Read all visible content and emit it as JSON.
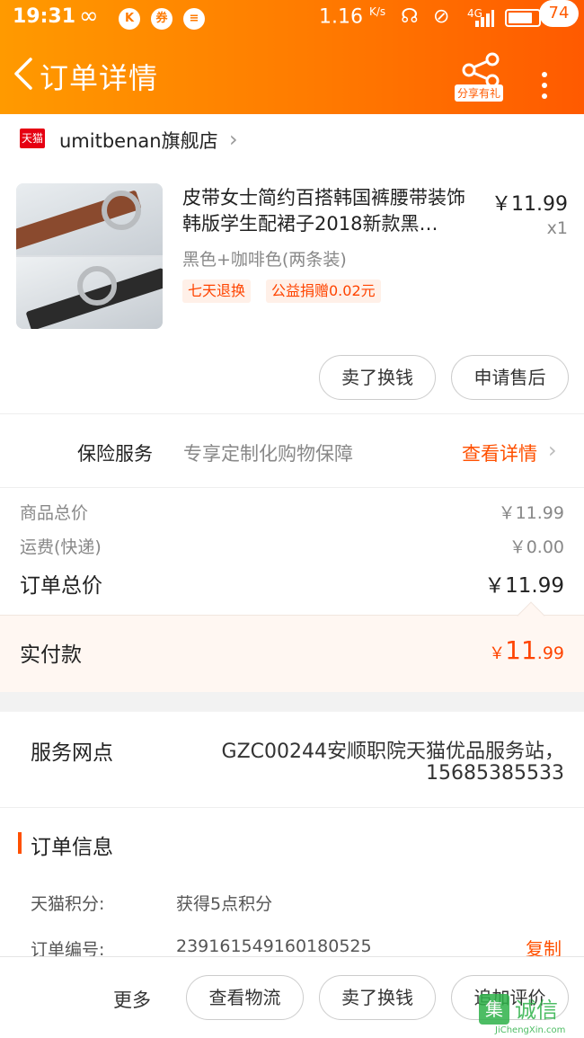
{
  "status_bar": {
    "time": "19:31",
    "speed": "1.16",
    "speed_unit": "K/s",
    "network": "4G",
    "battery": "71",
    "icon_names": [
      "infinity-icon",
      "k-icon",
      "coupon-icon",
      "chat-icon",
      "headset-icon",
      "mute-icon",
      "signal-icon",
      "battery-icon"
    ]
  },
  "nav": {
    "title": "订单详情",
    "share_label": "分享有礼",
    "badge_count": "74"
  },
  "shop": {
    "platform_logo": "天猫",
    "name": "umitbenan旗舰店"
  },
  "product": {
    "title": "皮带女士简约百搭韩国裤腰带装饰韩版学生配裙子2018新款黑…",
    "price": "￥11.99",
    "qty": "x1",
    "sku": "黑色+咖啡色(两条装)",
    "tags": [
      "七天退换",
      "公益捐赠0.02元"
    ],
    "actions": [
      "卖了换钱",
      "申请售后"
    ]
  },
  "insurance": {
    "label": "保险服务",
    "desc": "专享定制化购物保障",
    "link": "查看详情"
  },
  "summary": {
    "goods_label": "商品总价",
    "goods_value": "￥11.99",
    "shipping_label": "运费(快递)",
    "shipping_value": "￥0.00",
    "total_label": "订单总价",
    "total_value": "￥11.99"
  },
  "payment": {
    "label": "实付款",
    "currency": "￥",
    "int": "11",
    "dec": ".99"
  },
  "service_point": {
    "label": "服务网点",
    "line1": "GZC00244安顺职院天猫优品服务站，",
    "line2": "15685385533"
  },
  "order_info": {
    "heading": "订单信息",
    "points_label": "天猫积分:",
    "points_value": "获得5点积分",
    "number_label": "订单编号:",
    "number_value": "239161549160180525",
    "copy_label": "复制"
  },
  "bottom_bar": {
    "more": "更多",
    "buttons": [
      "查看物流",
      "卖了换钱",
      "追加评价"
    ]
  },
  "watermark": {
    "glyph": "集",
    "text": "诚信",
    "sub": "JiChengXin.com"
  },
  "colors": {
    "brand_orange": "#ff7a00",
    "accent_red": "#ff4400",
    "tmall_red": "#e60012"
  }
}
